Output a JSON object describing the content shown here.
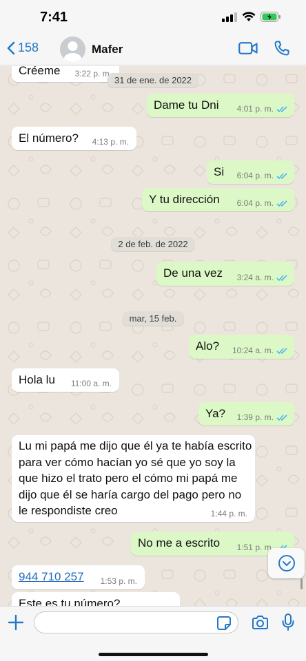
{
  "status_bar": {
    "time": "7:41"
  },
  "header": {
    "back_count": "158",
    "contact_name": "Mafer"
  },
  "chat": {
    "date_chips": [
      "31 de ene. de 2022",
      "2 de feb. de 2022",
      "mar, 15 feb."
    ],
    "messages": [
      {
        "direction": "in",
        "text": "Créeme",
        "time": "3:22 p. m."
      },
      {
        "direction": "out",
        "text": "Dame tu  Dni",
        "time": "4:01 p. m.",
        "read": true
      },
      {
        "direction": "in",
        "text": "El número?",
        "time": "4:13 p. m."
      },
      {
        "direction": "out",
        "text": "Si",
        "time": "6:04 p. m.",
        "read": true
      },
      {
        "direction": "out",
        "text": "Y tu dirección",
        "time": "6:04 p. m.",
        "read": true
      },
      {
        "direction": "out",
        "text": "De una vez",
        "time": "3:24 a. m.",
        "read": true
      },
      {
        "direction": "out",
        "text": "Alo?",
        "time": "10:24 a. m.",
        "read": true
      },
      {
        "direction": "in",
        "text": "Hola lu",
        "time": "11:00 a. m."
      },
      {
        "direction": "out",
        "text": "Ya?",
        "time": "1:39 p. m.",
        "read": true
      },
      {
        "direction": "in",
        "text": "Lu mi papá me dijo que él ya te había escrito para ver cómo hacían yo sé que yo soy la que hizo el trato pero el cómo mi papá me dijo que él se haría cargo del pago pero no le respondiste creo",
        "time": "1:44 p. m."
      },
      {
        "direction": "out",
        "text": "No me a escrito",
        "time": "1:51 p. m.",
        "read": true
      },
      {
        "direction": "in",
        "text": "944 710 257",
        "time": "1:53 p. m.",
        "link": true
      },
      {
        "direction": "in",
        "text": "Este es tu número?",
        "time": ""
      }
    ]
  },
  "composer": {
    "placeholder": ""
  },
  "colors": {
    "accent": "#2378c9",
    "outgoing_bubble": "#dcf8c6",
    "incoming_bubble": "#ffffff",
    "read_ticks": "#4fb6ec",
    "chat_background": "#ece5dd"
  },
  "icons": [
    "back-chevron-icon",
    "avatar-placeholder-icon",
    "video-call-icon",
    "phone-icon",
    "scroll-down-icon",
    "plus-icon",
    "sticker-icon",
    "camera-icon",
    "microphone-icon",
    "signal-icon",
    "wifi-icon",
    "battery-icon"
  ]
}
